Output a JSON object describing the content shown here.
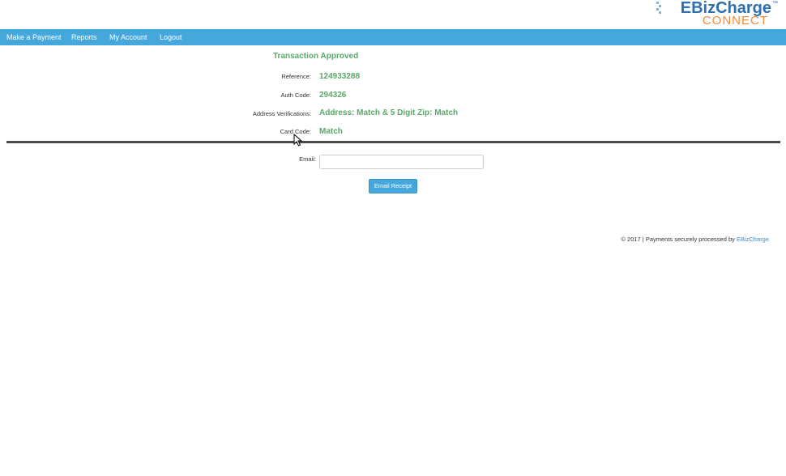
{
  "logo": {
    "main": "EBizCharge",
    "tm": "™",
    "sub": "CONNECT"
  },
  "nav": {
    "items": [
      {
        "label": "Make a Payment"
      },
      {
        "label": "Reports"
      },
      {
        "label": "My Account"
      },
      {
        "label": "Logout"
      }
    ]
  },
  "transaction": {
    "title": "Transaction Approved",
    "reference_label": "Reference:",
    "reference_value": "124933288",
    "auth_label": "Auth Code:",
    "auth_value": "294326",
    "avs_label": "Address Verifications:",
    "avs_value": "Address: Match & 5 Digit Zip: Match",
    "card_code_label": "Card Code:",
    "card_code_value": "Match"
  },
  "email_form": {
    "label": "Email:",
    "value": "",
    "placeholder": "",
    "button_label": "Email Receipt"
  },
  "footer": {
    "text": "© 2017 | Payments securely processed by ",
    "link_text": "EBizCharge"
  },
  "colors": {
    "navbar": "#45a8dc",
    "success_green": "#5aa86b",
    "logo_blue": "#2e6fb0",
    "logo_orange": "#ef8a3a"
  }
}
